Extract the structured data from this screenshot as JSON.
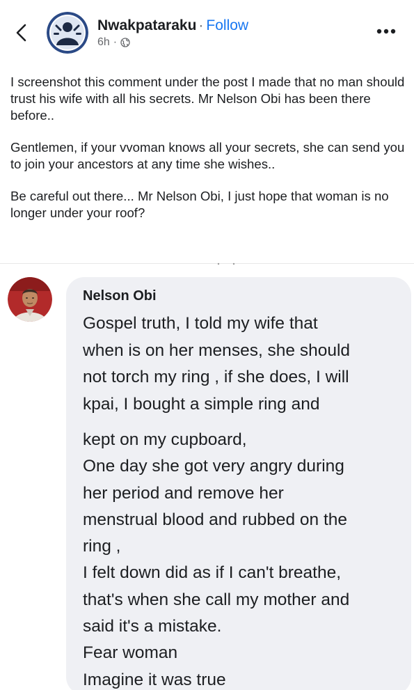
{
  "header": {
    "author_name": "Nwakpataraku",
    "separator": "·",
    "follow_label": "Follow",
    "time_ago": "6h",
    "meta_separator": "·",
    "audience_icon": "globe-icon",
    "back_icon": "chevron-left-icon",
    "more_icon": "more-horizontal-icon"
  },
  "post": {
    "paragraphs": [
      "I screenshot this comment under the post I made that no man should trust his wife with all his secrets. Mr Nelson Obi has been there before..",
      "Gentlemen, if your vvoman knows all your secrets, she can send you to join your ancestors at any time she wishes..",
      "Be careful out there... Mr Nelson Obi, I just hope that woman is no longer under your roof?"
    ]
  },
  "comment": {
    "author_name": "Nelson Obi",
    "text_part1": "Gospel truth, I told my wife that\nwhen is on her menses, she should\nnot torch my ring , if she does, I will\nkpai, I bought a simple ring and",
    "text_part2": "kept on my cupboard,\nOne day she got very angry during\nher period and remove her\nmenstrual blood and rubbed on the\nring ,\nI felt down did as if I can't breathe,\nthat's when she call my mother and\nsaid it's a mistake.\nFear woman\nImagine it was true"
  },
  "colors": {
    "link": "#1877f2",
    "secondary_text": "#65676b",
    "comment_bubble": "#eff0f4",
    "primary_text": "#1c1e21"
  }
}
